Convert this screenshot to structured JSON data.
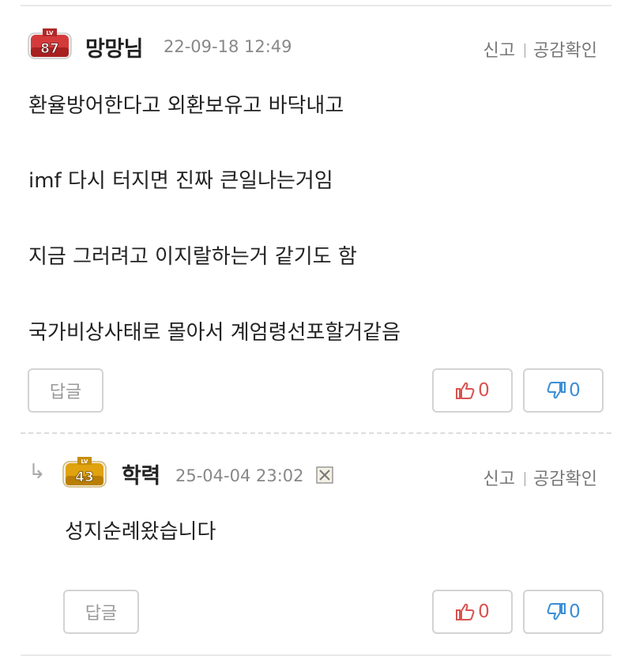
{
  "comments": [
    {
      "level": "87",
      "nickname": "망망님",
      "date": "22-09-18 12:49",
      "report_label": "신고",
      "likes_label": "공감확인",
      "lines": [
        "환율방어한다고 외환보유고 바닥내고",
        "imf 다시 터지면 진짜 큰일나는거임",
        "지금 그러려고 이지랄하는거 같기도 함",
        "국가비상사태로 몰아서 계엄령선포할거같음"
      ],
      "reply_label": "답글",
      "upvotes": "0",
      "downvotes": "0"
    }
  ],
  "replies": [
    {
      "reply_marker": "↳",
      "level": "43",
      "nickname": "학력",
      "date": "25-04-04 23:02",
      "report_label": "신고",
      "likes_label": "공감확인",
      "lines": [
        "성지순례왔습니다"
      ],
      "reply_label": "답글",
      "upvotes": "0",
      "downvotes": "0"
    }
  ],
  "badge_text": "LV",
  "colors": {
    "upvote": "#d9534f",
    "downvote": "#3a8ed6",
    "level87_badge": "#d43a3a",
    "level43_badge": "#e0a20e"
  },
  "icons": {
    "upvote": "thumbs-up-icon",
    "downvote": "thumbs-down-icon",
    "reply_marker": "reply-arrow-icon",
    "delete": "x-box-icon"
  }
}
